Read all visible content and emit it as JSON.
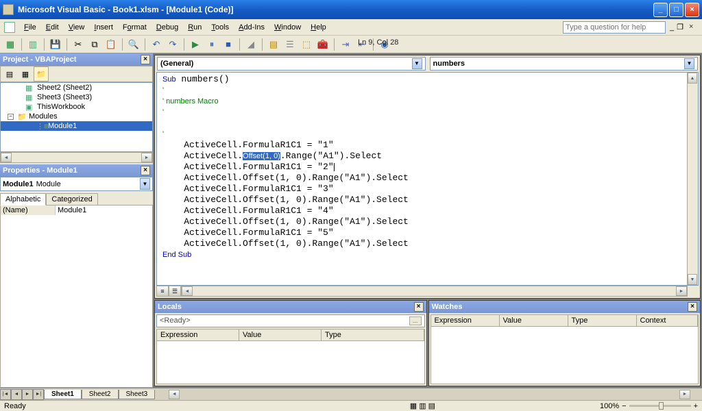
{
  "title": "Microsoft Visual Basic - Book1.xlsm - [Module1 (Code)]",
  "menus": [
    "File",
    "Edit",
    "View",
    "Insert",
    "Format",
    "Debug",
    "Run",
    "Tools",
    "Add-Ins",
    "Window",
    "Help"
  ],
  "search_placeholder": "Type a question for help",
  "cursor_pos": "Ln 9, Col 28",
  "project_panel_title": "Project - VBAProject",
  "properties_panel_title": "Properties - Module1",
  "tree": {
    "items": [
      {
        "label": "Sheet2 (Sheet2)",
        "icon": "sheet"
      },
      {
        "label": "Sheet3 (Sheet3)",
        "icon": "sheet"
      },
      {
        "label": "ThisWorkbook",
        "icon": "book"
      },
      {
        "label": "Modules",
        "icon": "folder",
        "expand": "−",
        "level": "root"
      },
      {
        "label": "Module1",
        "icon": "module",
        "selected": true,
        "level": "l4"
      }
    ]
  },
  "prop_combo": {
    "bold": "Module1",
    "rest": "Module"
  },
  "prop_tabs": [
    "Alphabetic",
    "Categorized"
  ],
  "prop_grid": [
    {
      "name": "(Name)",
      "value": "Module1"
    }
  ],
  "code_left_combo": "(General)",
  "code_right_combo": "numbers",
  "code": {
    "lines": [
      {
        "t": "Sub",
        "kw": true,
        "rest": " numbers()"
      },
      {
        "cm": "'"
      },
      {
        "cm": "' numbers Macro"
      },
      {
        "cm": "'"
      },
      {
        "blank": true
      },
      {
        "cm": "'"
      },
      {
        "plain": "    ActiveCell.FormulaR1C1 = \"1\""
      },
      {
        "pre": "    ActiveCell.",
        "hl": "Offset(1, 0)",
        "post": ".Range(\"A1\").Select"
      },
      {
        "plain": "    ActiveCell.FormulaR1C1 = \"2\"",
        "caret": true
      },
      {
        "plain": "    ActiveCell.Offset(1, 0).Range(\"A1\").Select"
      },
      {
        "plain": "    ActiveCell.FormulaR1C1 = \"3\""
      },
      {
        "plain": "    ActiveCell.Offset(1, 0).Range(\"A1\").Select"
      },
      {
        "plain": "    ActiveCell.FormulaR1C1 = \"4\""
      },
      {
        "plain": "    ActiveCell.Offset(1, 0).Range(\"A1\").Select"
      },
      {
        "plain": "    ActiveCell.FormulaR1C1 = \"5\""
      },
      {
        "plain": "    ActiveCell.Offset(1, 0).Range(\"A1\").Select"
      },
      {
        "t": "End Sub",
        "kw": true
      }
    ]
  },
  "locals_title": "Locals",
  "locals_ready": "<Ready>",
  "locals_cols": [
    "Expression",
    "Value",
    "Type"
  ],
  "watches_title": "Watches",
  "watches_cols": [
    "Expression",
    "Value",
    "Type",
    "Context"
  ],
  "sheets": [
    "Sheet1",
    "Sheet2",
    "Sheet3"
  ],
  "status_ready": "Ready",
  "zoom": "100%",
  "zoom_btns": {
    "out": "−",
    "in": "+"
  }
}
